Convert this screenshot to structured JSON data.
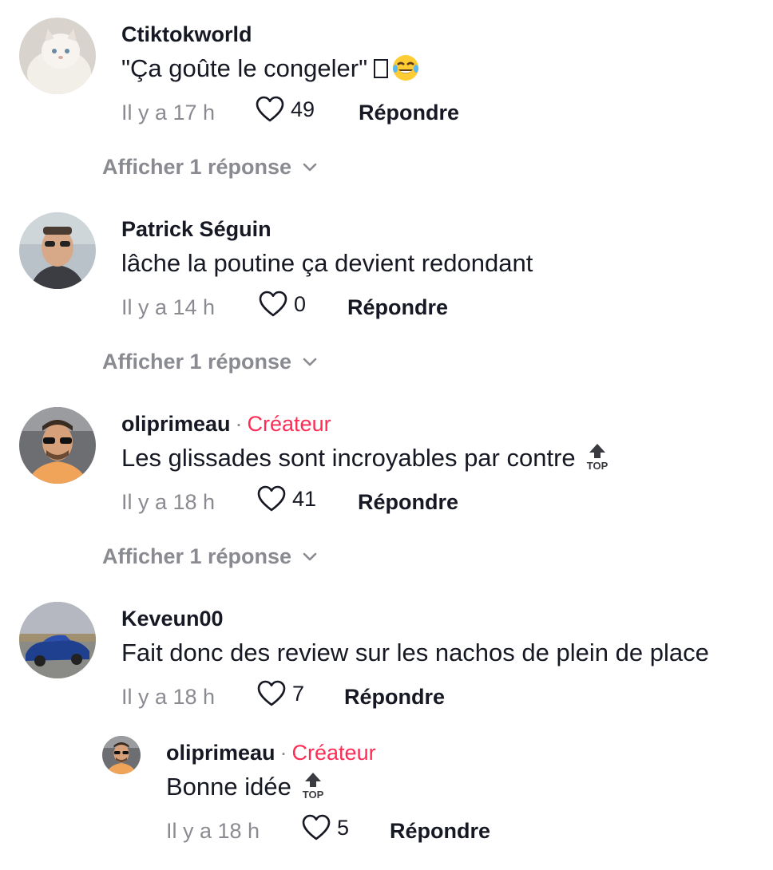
{
  "comments": [
    {
      "username": "Ctiktokworld",
      "text": "\"Ça goûte le congeler\"",
      "time": "Il y a 17 h",
      "likes": "49",
      "reply_label": "Répondre",
      "view_replies": "Afficher 1 réponse",
      "avatar_icon": "white-cat-avatar"
    },
    {
      "username": "Patrick Séguin",
      "text": "lâche la poutine ça devient redondant",
      "time": "Il y a 14 h",
      "likes": "0",
      "reply_label": "Répondre",
      "view_replies": "Afficher 1 réponse",
      "avatar_icon": "man-sunglasses-avatar"
    },
    {
      "username": "oliprimeau",
      "separator": "·",
      "badge": "Créateur",
      "text": "Les glissades sont incroyables par contre",
      "top_label": "TOP",
      "time": "Il y a 18 h",
      "likes": "41",
      "reply_label": "Répondre",
      "view_replies": "Afficher 1 réponse",
      "avatar_icon": "man-sunglasses-orange-avatar"
    },
    {
      "username": "Keveun00",
      "text": "Fait donc des review sur les nachos de plein de place",
      "time": "Il y a 18 h",
      "likes": "7",
      "reply_label": "Répondre",
      "avatar_icon": "blue-car-avatar"
    }
  ],
  "reply": {
    "username": "oliprimeau",
    "separator": "·",
    "badge": "Créateur",
    "text": "Bonne idée",
    "top_label": "TOP",
    "time": "Il y a 18 h",
    "likes": "5",
    "reply_label": "Répondre",
    "avatar_icon": "man-sunglasses-orange-avatar"
  },
  "colors": {
    "text": "#161823",
    "secondary": "#8a8b91",
    "creator": "#fe2c55"
  }
}
